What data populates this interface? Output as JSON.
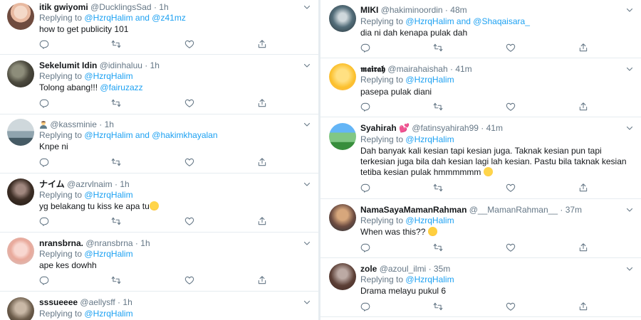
{
  "left_column": [
    {
      "name": "itik gwiyomi",
      "handle": "@DucklingsSad",
      "time": "1h",
      "reply_prefix": "Replying to",
      "mention1": "@HzrqHalim",
      "reply_and": "and",
      "mention2": "@z41mz",
      "text": "how to get publicity 101"
    },
    {
      "name": "Sekelumit Idin",
      "handle": "@idinhaluu",
      "time": "1h",
      "reply_prefix": "Replying to",
      "mention1": "@HzrqHalim",
      "text": "Tolong abang!!!",
      "text_mention": "@fairuzazz"
    },
    {
      "name": "",
      "handle": "@kassminie",
      "time": "1h",
      "reply_prefix": "Replying to",
      "mention1": "@HzrqHalim",
      "reply_and": "and",
      "mention2": "@hakimkhayalan",
      "text": "Knpe ni"
    },
    {
      "name": "ナイム",
      "handle": "@azrvlnaim",
      "time": "1h",
      "reply_prefix": "Replying to",
      "mention1": "@HzrqHalim",
      "text": "yg belakang tu kiss ke apa tu"
    },
    {
      "name": "nransbrna.",
      "handle": "@nransbrna",
      "time": "1h",
      "reply_prefix": "Replying to",
      "mention1": "@HzrqHalim",
      "text": "ape kes dowhh"
    },
    {
      "name": "sssueeee",
      "handle": "@aellysff",
      "time": "1h",
      "reply_prefix": "Replying to",
      "mention1": "@HzrqHalim"
    }
  ],
  "right_column": [
    {
      "name": "MIKI",
      "handle": "@hakiminoordin",
      "time": "48m",
      "reply_prefix": "Replying to",
      "mention1": "@HzrqHalim",
      "reply_and": "and",
      "mention2": "@Shaqaisara_",
      "text": "dia ni dah kenapa pulak dah"
    },
    {
      "name": "𝖒𝖆𝖎𝖗𝖆𝖍",
      "handle": "@mairahaishah",
      "time": "41m",
      "reply_prefix": "Replying to",
      "mention1": "@HzrqHalim",
      "text": "pasepa pulak diani"
    },
    {
      "name": "Syahirah",
      "handle": "@fatinsyahirah99",
      "time": "41m",
      "reply_prefix": "Replying to",
      "mention1": "@HzrqHalim",
      "text": "Dah banyak kali kesian tapi kesian juga. Taknak kesian pun tapi terkesian juga bila dah kesian lagi lah kesian. Pastu bila taknak kesian tetiba kesian pulak hmmmmmm"
    },
    {
      "name": "NamaSayaMamanRahman",
      "handle": "@__MamanRahman__",
      "time": "37m",
      "reply_prefix": "Replying to",
      "mention1": "@HzrqHalim",
      "text": "When was this??"
    },
    {
      "name": "zole",
      "handle": "@azoul_ilmi",
      "time": "35m",
      "reply_prefix": "Replying to",
      "mention1": "@HzrqHalim",
      "text": "Drama melayu pukul 6"
    }
  ],
  "separator": "·",
  "icons": [
    "reply-icon",
    "retweet-icon",
    "like-icon",
    "share-icon",
    "chevron-down-icon"
  ],
  "colors": {
    "text": "#14171a",
    "secondary": "#657786",
    "link": "#1da1f2",
    "border": "#e6ecf0"
  }
}
